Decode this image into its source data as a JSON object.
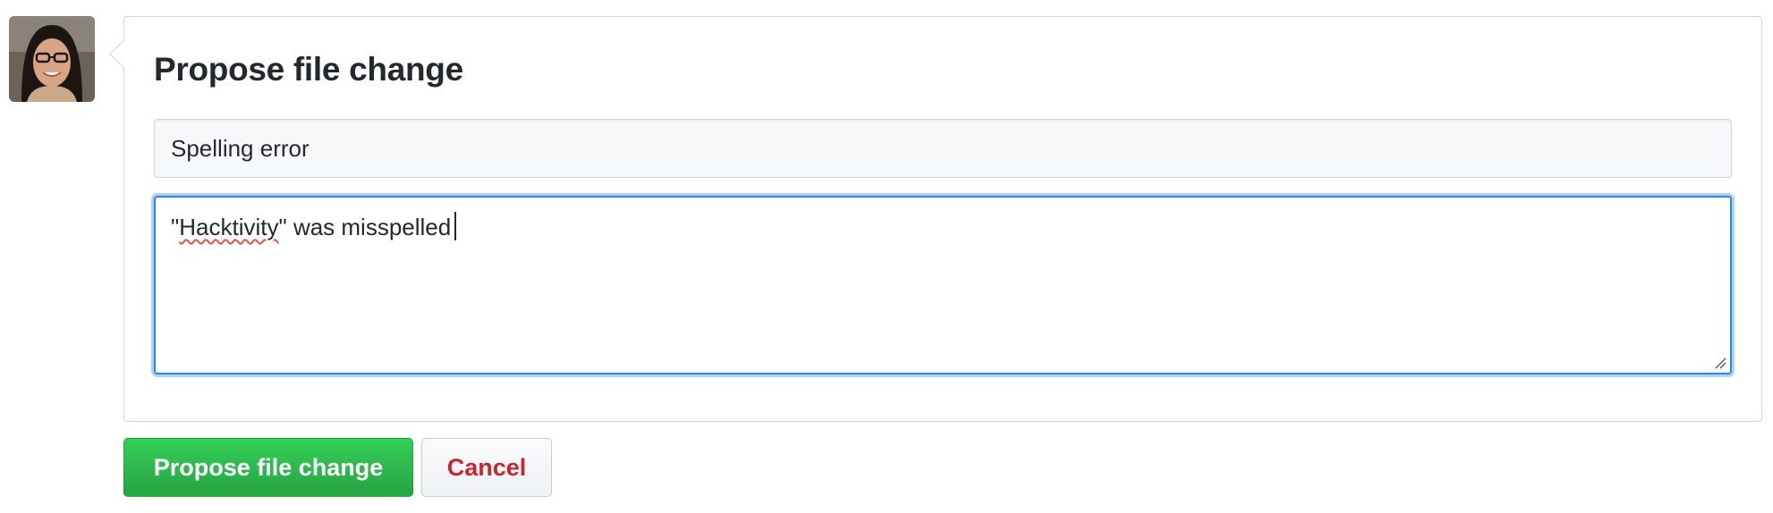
{
  "user": {
    "avatar_icon": "user-avatar-photo"
  },
  "form": {
    "title": "Propose file change",
    "summary_value": "Spelling error",
    "description_misspelled_word": "Hacktivity",
    "description_prefix": "\"",
    "description_suffix": "\" was misspelled"
  },
  "actions": {
    "submit_label": "Propose file change",
    "cancel_label": "Cancel"
  },
  "colors": {
    "primary_button": "#28a745",
    "cancel_text": "#cb2431",
    "focus_border": "#2188ff",
    "spellcheck_underline": "#e5534b"
  }
}
